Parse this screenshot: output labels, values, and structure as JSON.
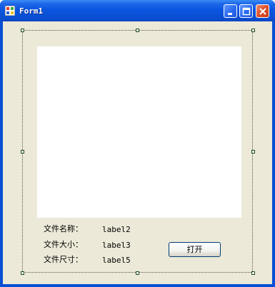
{
  "window": {
    "title": "Form1",
    "accent_color": "#0a4fd4",
    "client_color": "#ece9d8"
  },
  "caption_buttons": {
    "minimize_icon": "minimize-icon",
    "maximize_icon": "maximize-icon",
    "close_icon": "close-icon"
  },
  "form": {
    "file_name_label": "文件名称：",
    "file_name_value": "label2",
    "file_size_label": "文件大小：",
    "file_size_value": "label3",
    "file_dim_label": "文件尺寸：",
    "file_dim_value": "label5",
    "open_button": "打开"
  }
}
